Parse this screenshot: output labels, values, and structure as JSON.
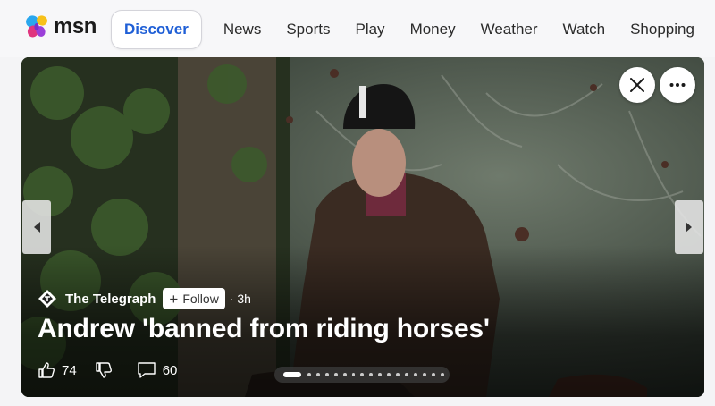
{
  "brand": {
    "name": "msn"
  },
  "nav": {
    "discover": "Discover",
    "items": [
      "News",
      "Sports",
      "Play",
      "Money",
      "Weather",
      "Watch",
      "Shopping"
    ]
  },
  "card": {
    "source": "The Telegraph",
    "follow_label": "Follow",
    "time": "· 3h",
    "headline": "Andrew 'banned from riding horses'",
    "likes": "74",
    "comments": "60",
    "carousel": {
      "total": 17,
      "active_index": 0
    }
  },
  "icons": {
    "close": "close-icon",
    "more": "more-icon",
    "prev": "chevron-left-icon",
    "next": "chevron-right-icon",
    "like": "thumbs-up-icon",
    "dislike": "thumbs-down-icon",
    "comment": "comment-icon"
  },
  "colors": {
    "accent": "#1f5fd6"
  }
}
